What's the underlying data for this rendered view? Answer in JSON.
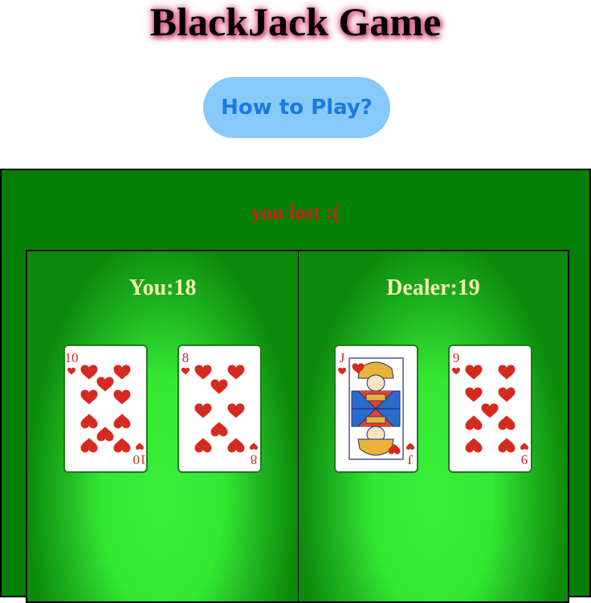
{
  "header": {
    "title": "BlackJack Game"
  },
  "controls": {
    "how_to_play": "How to Play?"
  },
  "table": {
    "result_text": "you lost :(",
    "player": {
      "label": "You:18",
      "cards": [
        {
          "rank": "10",
          "suit": "hearts"
        },
        {
          "rank": "8",
          "suit": "hearts"
        }
      ]
    },
    "dealer": {
      "label": "Dealer:19",
      "cards": [
        {
          "rank": "J",
          "suit": "hearts"
        },
        {
          "rank": "9",
          "suit": "hearts"
        }
      ]
    }
  },
  "colors": {
    "table_green": "#038003",
    "felt_light": "#39ef39",
    "result_red": "#d11d1d",
    "score_cream": "#f3ecb0",
    "button_bg": "#87c9f9",
    "button_text": "#1a7ae0",
    "heart_red": "#d62a1e"
  }
}
